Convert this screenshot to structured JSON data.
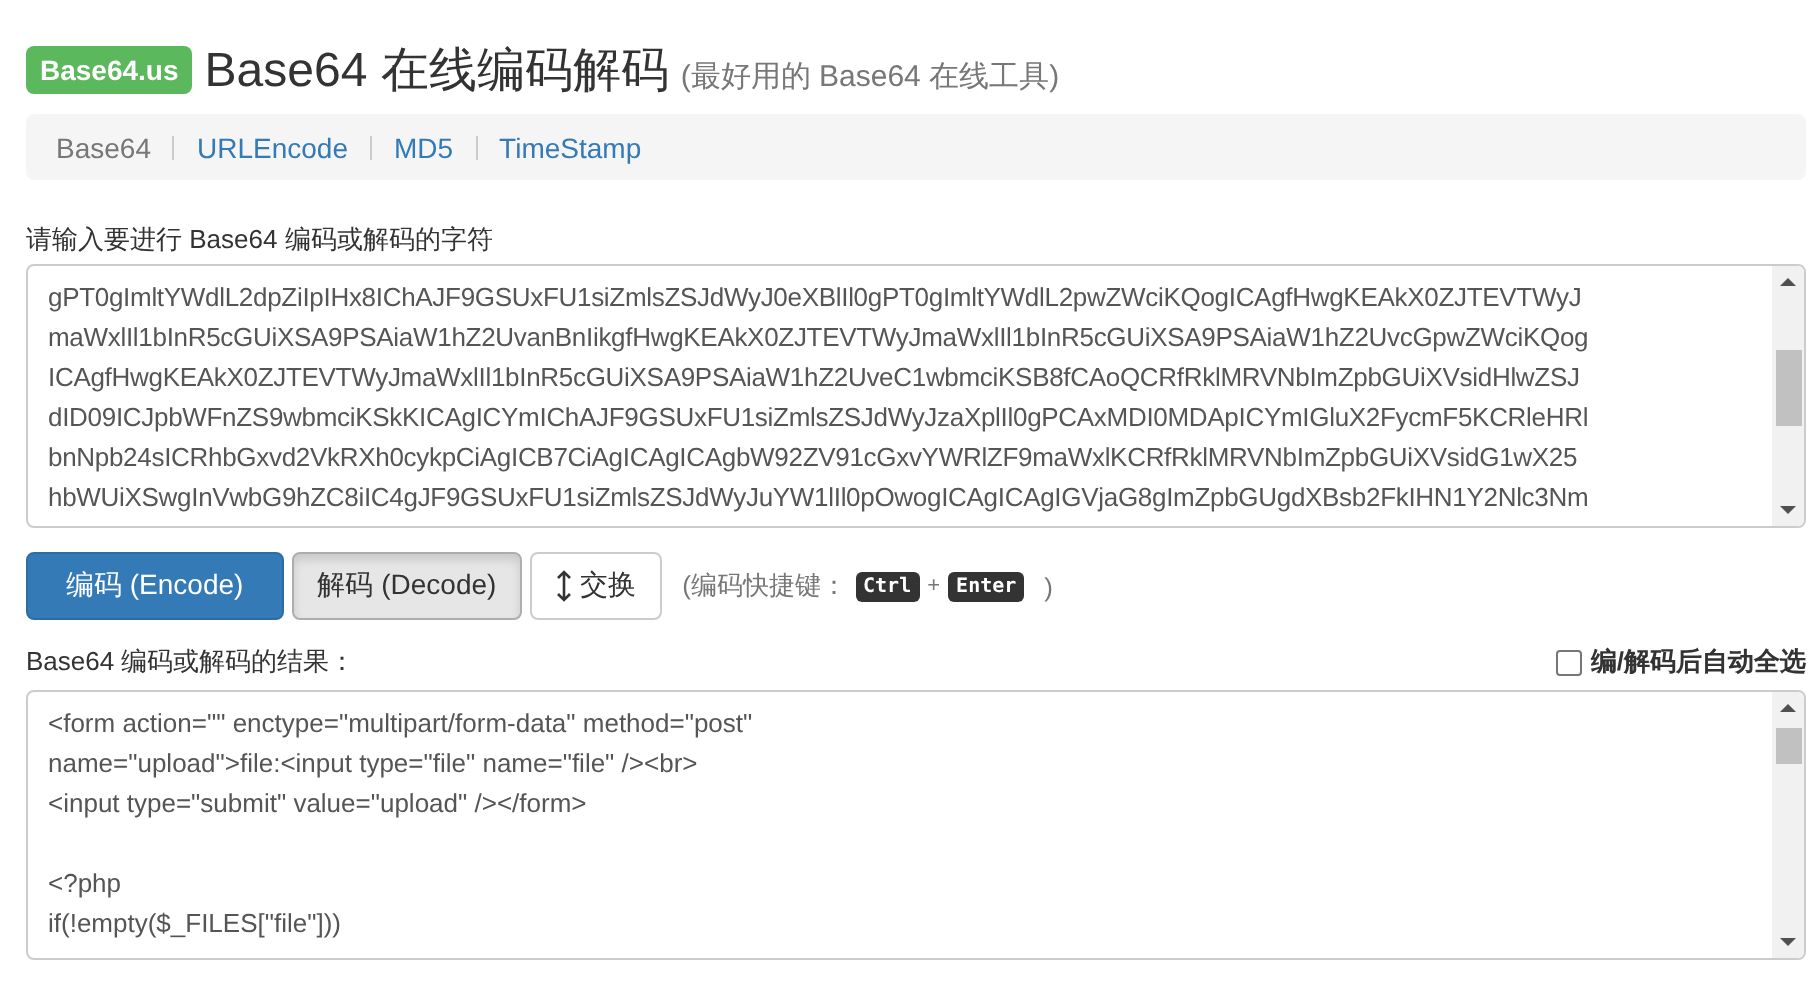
{
  "header": {
    "badge": "Base64.us",
    "title": "Base64 在线编码解码",
    "subtitle": "(最好用的 Base64 在线工具)"
  },
  "nav": [
    {
      "label": "Base64",
      "selected": true
    },
    {
      "label": "URLEncode",
      "selected": false
    },
    {
      "label": "MD5",
      "selected": false
    },
    {
      "label": "TimeStamp",
      "selected": false
    }
  ],
  "input": {
    "label": "请输入要进行 Base64 编码或解码的字符",
    "lines": [
      "gPT0gImltYWdlL2dpZiIpIHx8IChAJF9GSUxFU1siZmlsZSJdWyJ0eXBlIl0gPT0gImltYWdlL2pwZWciKQogICAgfHwgKEAkX0ZJTEVTWyJ",
      "maWxlIl1bInR5cGUiXSA9PSAiaW1hZ2UvanBnIikgfHwgKEAkX0ZJTEVTWyJmaWxlIl1bInR5cGUiXSA9PSAiaW1hZ2UvcGpwZWciKQog",
      "ICAgfHwgKEAkX0ZJTEVTWyJmaWxlIl1bInR5cGUiXSA9PSAiaW1hZ2UveC1wbmciKSB8fCAoQCRfRklMRVNbImZpbGUiXVsidHlwZSJ",
      "dID09ICJpbWFnZS9wbmciKSkKICAgICYmIChAJF9GSUxFU1siZmlsZSJdWyJzaXplIl0gPCAxMDI0MDApICYmIGluX2FycmF5KCRleHRl",
      "bnNpb24sICRhbGxvd2VkRXh0cykpCiAgICB7CiAgICAgICAgbW92ZV91cGxvYWRlZF9maWxlKCRfRklMRVNbImZpbGUiXVsidG1wX25",
      "hbWUiXSwgInVwbG9hZC8iIC4gJF9GSUxFU1siZmlsZSJdWyJuYW1lIl0pOwogICAgICAgIGVjaG8gImZpbGUgdXBsb2FkIHN1Y2Nlc3Nm"
    ]
  },
  "buttons": [
    {
      "label": "编码 (Encode)",
      "kind": "primary"
    },
    {
      "label": "解码 (Decode)",
      "kind": "active"
    },
    {
      "label": "交换",
      "kind": "swap"
    }
  ],
  "shortcut": {
    "prefix": "(编码快捷键：",
    "keys": [
      "Ctrl",
      "Enter"
    ],
    "plus": "+",
    "suffix": ")"
  },
  "output": {
    "label": "Base64 编码或解码的结果：",
    "auto_select": {
      "label": "编/解码后自动全选",
      "checked": false
    },
    "paragraphs": [
      [
        "<form action=\"\" enctype=\"multipart/form-data\" method=\"post\"",
        "name=\"upload\">file:<input type=\"file\" name=\"file\" /><br>",
        "<input type=\"submit\" value=\"upload\" /></form>"
      ],
      [
        "<?php",
        "if(!empty($_FILES[\"file\"]))"
      ]
    ]
  }
}
